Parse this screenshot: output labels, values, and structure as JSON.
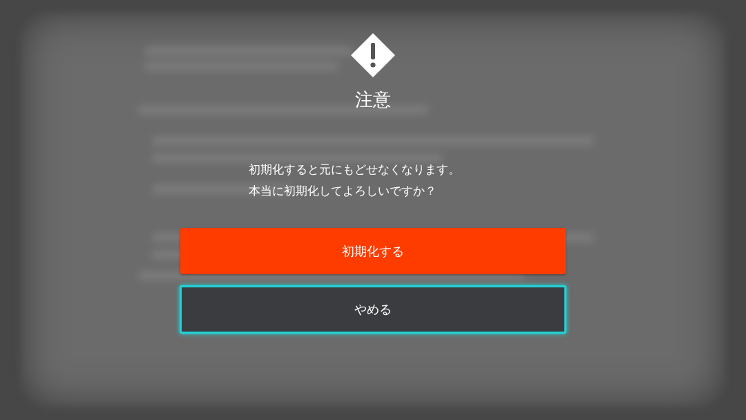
{
  "dialog": {
    "title": "注意",
    "message": [
      "初期化すると元にもどせなくなります。",
      "本当に初期化してよろしいですか？"
    ],
    "buttons": [
      {
        "label": "初期化する",
        "kind": "danger",
        "selected": false
      },
      {
        "label": "やめる",
        "kind": "normal",
        "selected": true
      }
    ]
  }
}
